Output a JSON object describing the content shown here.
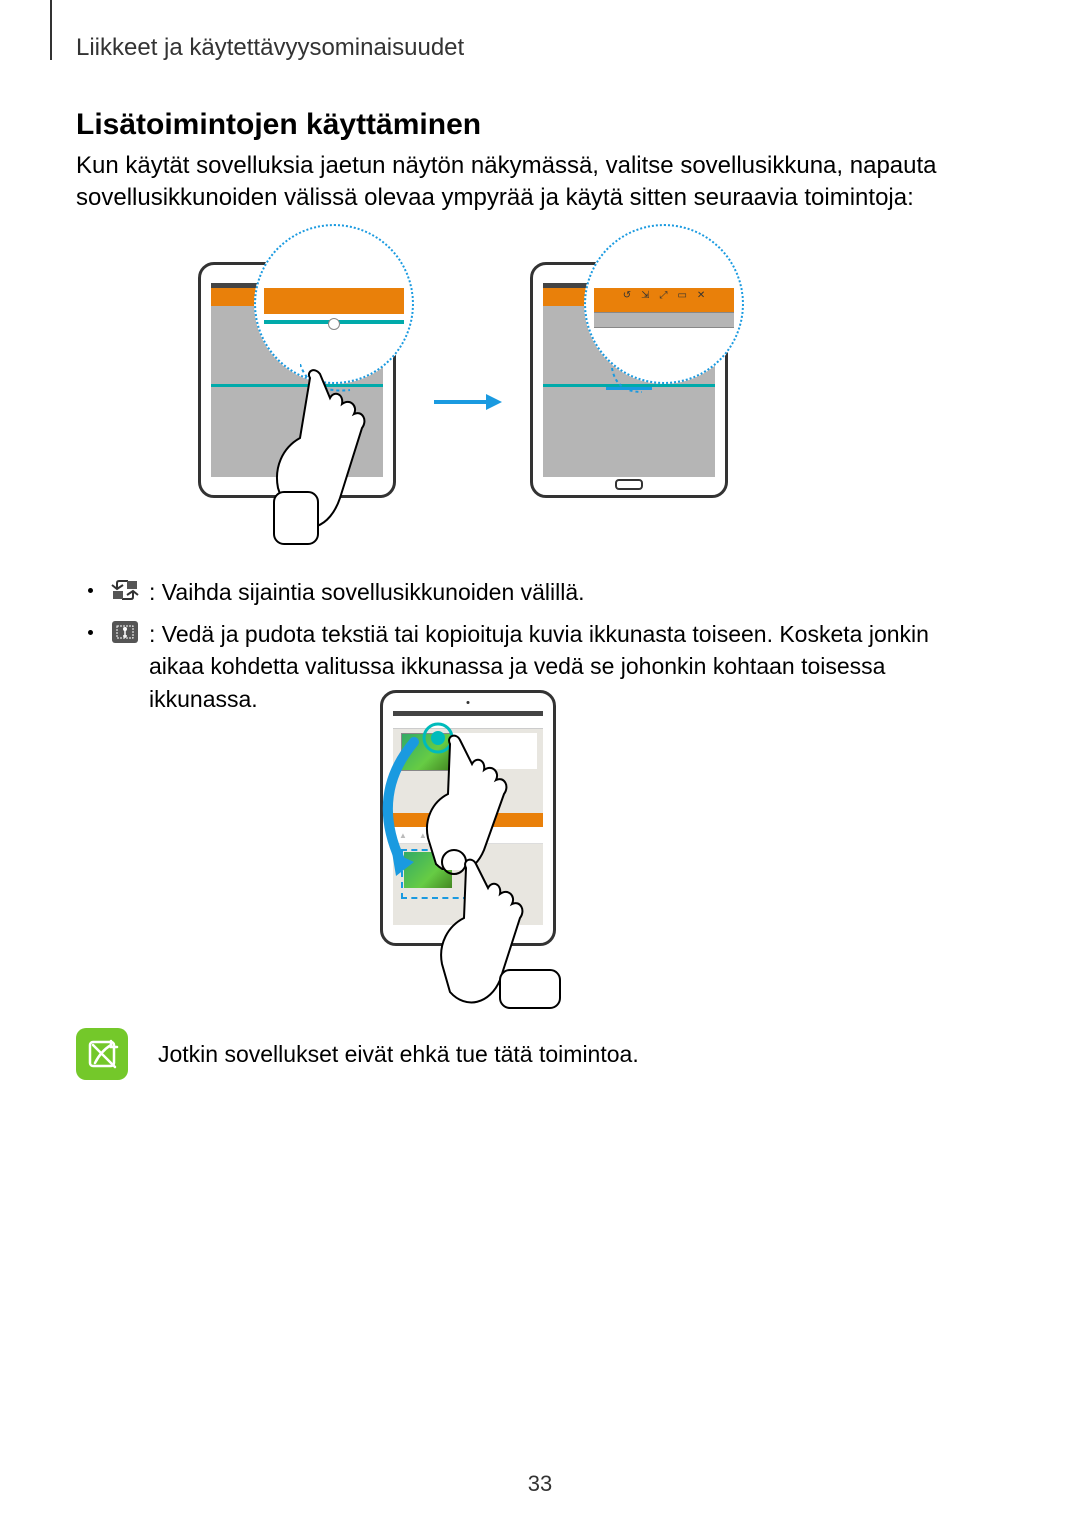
{
  "header": {
    "breadcrumb": "Liikkeet ja käytettävyysominaisuudet"
  },
  "section": {
    "title": "Lisätoimintojen käyttäminen"
  },
  "intro": {
    "text": "Kun käytät sovelluksia jaetun näytön näkymässä, valitse sovellusikkuna, napauta sovellusikkunoiden välissä olevaa ympyrää ja käytä sitten seuraavia toimintoja:"
  },
  "bullets": {
    "b1": {
      "text": ": Vaihda sijaintia sovellusikkunoiden välillä."
    },
    "b2": {
      "text": ": Vedä ja pudota tekstiä tai kopioituja kuvia ikkunasta toiseen. Kosketa jonkin aikaa kohdetta valitussa ikkunassa ja vedä se johonkin kohtaan toisessa ikkunassa."
    }
  },
  "note": {
    "text": "Jotkin sovellukset eivät ehkä tue tätä toimintoa."
  },
  "page": {
    "number": "33"
  }
}
